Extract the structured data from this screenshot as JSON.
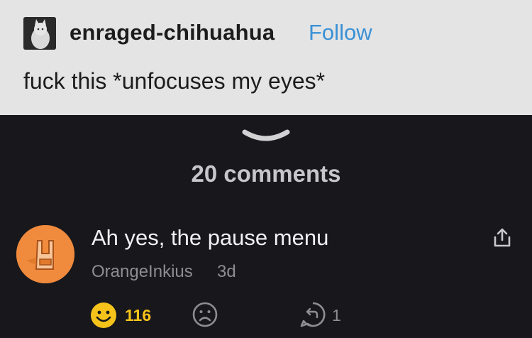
{
  "post": {
    "username": "enraged-chihuahua",
    "follow_label": "Follow",
    "text": "fuck this *unfocuses my eyes*"
  },
  "comments": {
    "count_label": "20 comments",
    "items": [
      {
        "text": "Ah yes, the pause menu",
        "author": "OrangeInkius",
        "time": "3d",
        "likes": "116",
        "replies": "1"
      }
    ]
  },
  "icons": {
    "expand": "chevron-down-icon",
    "share": "share-icon",
    "like": "smile-icon",
    "dislike": "sad-face-icon",
    "reply": "reply-icon"
  },
  "colors": {
    "post_bg": "#e4e4e4",
    "comments_bg": "#18181c",
    "follow": "#3a91d6",
    "like_accent": "#f6c31a",
    "avatar_orange": "#f08a3c"
  }
}
